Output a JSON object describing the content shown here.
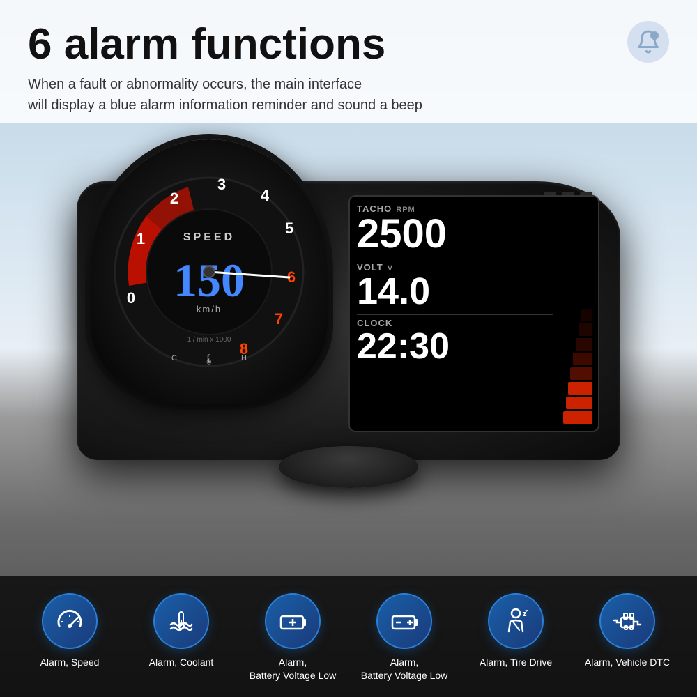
{
  "page": {
    "title": "6 alarm functions",
    "subtitle_line1": "When a fault or abnormality occurs, the main interface",
    "subtitle_line2": "will display a blue alarm information reminder and sound a beep"
  },
  "device": {
    "gauge": {
      "speed_label": "SPEED",
      "speed_value": "150",
      "speed_unit": "km/h",
      "rpm_sub": "1 / min x 1000"
    },
    "display": {
      "tacho_label": "TACHO",
      "tacho_unit": "RPM",
      "tacho_value": "2500",
      "volt_label": "VOLT",
      "volt_unit": "V",
      "volt_value": "14.0",
      "clock_label": "CLOCK",
      "clock_value": "22:30"
    }
  },
  "alarms": [
    {
      "id": "speed",
      "label": "Alarm, Speed",
      "icon": "speedometer"
    },
    {
      "id": "coolant",
      "label": "Alarm, Coolant",
      "icon": "coolant"
    },
    {
      "id": "battery-low-1",
      "label": "Alarm,\nBattery Voltage Low",
      "icon": "battery"
    },
    {
      "id": "battery-low-2",
      "label": "Alarm,\nBattery Voltage Low",
      "icon": "battery-plus"
    },
    {
      "id": "tire",
      "label": "Alarm, Tire Drive",
      "icon": "driver"
    },
    {
      "id": "dtc",
      "label": "Alarm, Vehicle DTC",
      "icon": "engine"
    }
  ],
  "colors": {
    "accent_blue": "#1a5fa8",
    "display_red": "#cc2200",
    "speed_blue": "#4488ff",
    "text_dark": "#111111",
    "bell_color": "#8aa8c8"
  }
}
